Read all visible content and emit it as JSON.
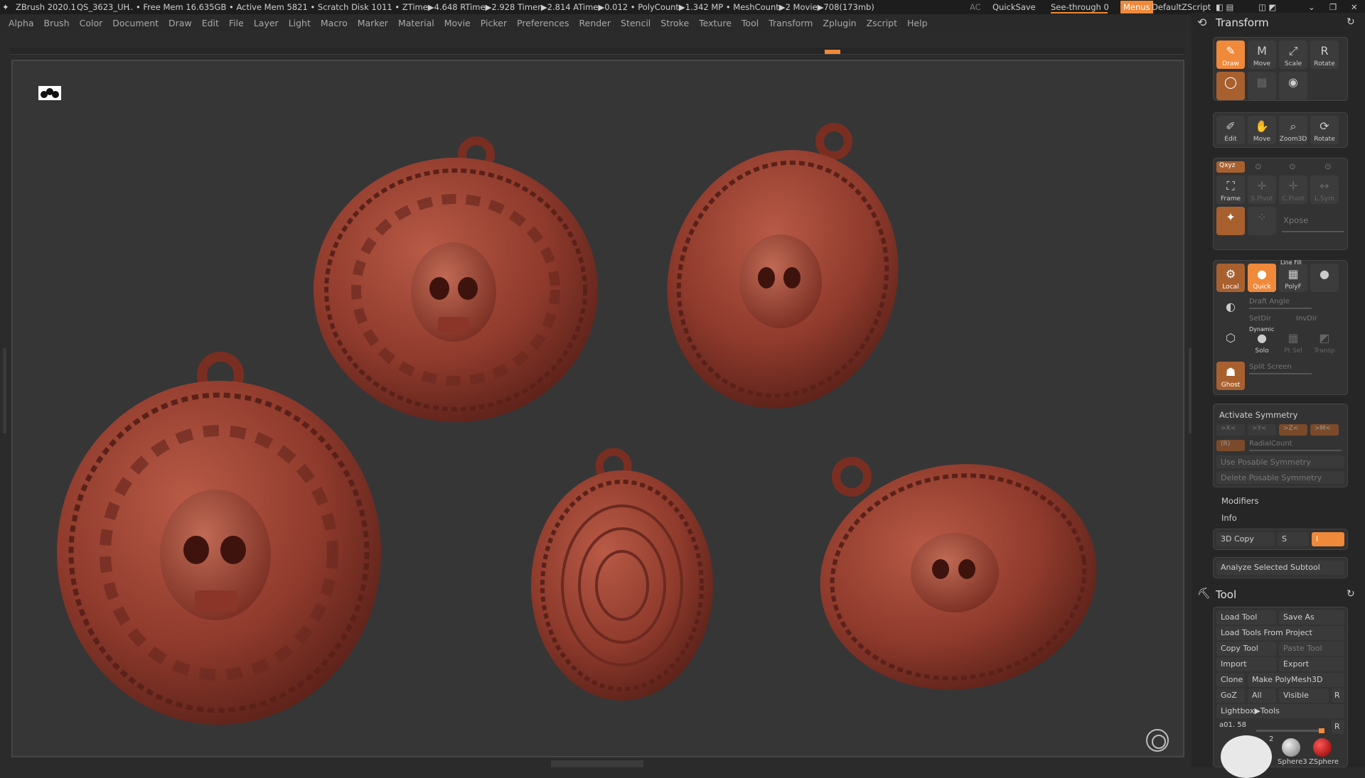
{
  "titlebar": {
    "app": "ZBrush 2020.1",
    "doc": "QS_3623_UH",
    "stats": ".. • Free Mem 16.635GB • Active Mem 5821 • Scratch Disk 1011 • ZTime▶4.648 RTime▶2.928 Timer▶2.814 ATime▶0.012 • PolyCount▶1.342 MP • MeshCount▶2 Movie▶708(173mb)",
    "ac": "AC",
    "quicksave": "QuickSave",
    "see_through": "See-through 0",
    "menus": "Menus",
    "script": "DefaultZScript"
  },
  "menu": [
    "Alpha",
    "Brush",
    "Color",
    "Document",
    "Draw",
    "Edit",
    "File",
    "Layer",
    "Light",
    "Macro",
    "Marker",
    "Material",
    "Movie",
    "Picker",
    "Preferences",
    "Render",
    "Stencil",
    "Stroke",
    "Texture",
    "Tool",
    "Transform",
    "Zplugin",
    "Zscript",
    "Help"
  ],
  "colors": {
    "accent": "#f0893a",
    "mesh": "#8f3a2c",
    "mesh_dark": "#5a2119",
    "mesh_light": "#b85a46"
  },
  "transform": {
    "title": "Transform",
    "row1": [
      "Draw",
      "Move",
      "Scale",
      "Rotate"
    ],
    "row3": [
      "Edit",
      "Move",
      "Zoom3D",
      "Rotate"
    ],
    "xyz": "Qxyz",
    "row4": [
      "Frame",
      "S.Pivot",
      "C.Pivot",
      "L.Sym"
    ],
    "lsym": "L.Sym",
    "xpose": "Xpose",
    "row5": [
      "Local",
      "Quick",
      "PolyF"
    ],
    "line_fill": "Line Fill",
    "draft_angle": "Draft Angle",
    "setdir": "SetDir",
    "invdir": "InvDir",
    "dynamic": "Dynamic",
    "solo": "Solo",
    "ptsel": "Pt Sel",
    "transp": "Transp",
    "ghost": "Ghost",
    "split_screen": "Split Screen",
    "activate_symmetry": "Activate Symmetry",
    "sym_axes": [
      ">X<",
      ">Y<",
      ">Z<",
      ">M<"
    ],
    "radial_r": "(R)",
    "radialcount": "RadialCount",
    "use_posable": "Use Posable Symmetry",
    "delete_posable": "Delete Posable Symmetry",
    "modifiers": "Modifiers",
    "info": "Info",
    "copy3d": "3D Copy",
    "copy_s": "S",
    "copy_i": "I",
    "analyze": "Analyze Selected Subtool"
  },
  "tool": {
    "title": "Tool",
    "load_tool": "Load Tool",
    "save_as": "Save As",
    "load_from_project": "Load Tools From Project",
    "copy_tool": "Copy Tool",
    "paste_tool": "Paste Tool",
    "import": "Import",
    "export": "Export",
    "clone": "Clone",
    "make_polymesh": "Make PolyMesh3D",
    "goz": "GoZ",
    "all": "All",
    "visible": "Visible",
    "r": "R",
    "lightbox": "Lightbox▶Tools",
    "current": "a01. 58",
    "count": "2",
    "sphere3": "Sphere3",
    "zsphere": "ZSphere"
  }
}
